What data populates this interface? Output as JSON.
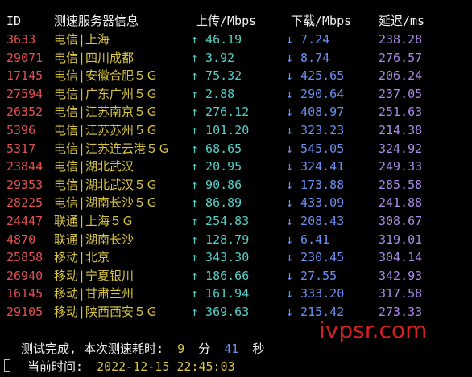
{
  "header": {
    "id": "ID",
    "node": "测速服务器信息",
    "up": "上传/Mbps",
    "down": "下载/Mbps",
    "lat": "延迟/ms"
  },
  "rows": [
    {
      "id": "3633",
      "node": "电信|上海",
      "up": "↑ 46.19",
      "down": "↓ 7.24",
      "lat": "238.28"
    },
    {
      "id": "29071",
      "node": "电信|四川成都",
      "up": "↑ 3.92",
      "down": "↓ 8.74",
      "lat": "276.57"
    },
    {
      "id": "17145",
      "node": "电信|安徽合肥５Ｇ",
      "up": "↑ 75.32",
      "down": "↓ 425.65",
      "lat": "206.24"
    },
    {
      "id": "27594",
      "node": "电信|广东广州５Ｇ",
      "up": "↑ 2.88",
      "down": "↓ 290.64",
      "lat": "237.05"
    },
    {
      "id": "26352",
      "node": "电信|江苏南京５Ｇ",
      "up": "↑ 276.12",
      "down": "↓ 408.97",
      "lat": "251.63"
    },
    {
      "id": "5396",
      "node": "电信|江苏苏州５Ｇ",
      "up": "↑ 101.20",
      "down": "↓ 323.23",
      "lat": "214.38"
    },
    {
      "id": "5317",
      "node": "电信|江苏连云港５Ｇ",
      "up": "↑ 68.65",
      "down": "↓ 545.05",
      "lat": "324.92"
    },
    {
      "id": "23844",
      "node": "电信|湖北武汉",
      "up": "↑ 20.95",
      "down": "↓ 324.41",
      "lat": "249.33"
    },
    {
      "id": "29353",
      "node": "电信|湖北武汉５Ｇ",
      "up": "↑ 90.86",
      "down": "↓ 173.88",
      "lat": "285.58"
    },
    {
      "id": "28225",
      "node": "电信|湖南长沙５Ｇ",
      "up": "↑ 86.89",
      "down": "↓ 433.09",
      "lat": "241.88"
    },
    {
      "id": "24447",
      "node": "联通|上海５Ｇ",
      "up": "↑ 254.83",
      "down": "↓ 208.43",
      "lat": "308.67"
    },
    {
      "id": "4870",
      "node": "联通|湖南长沙",
      "up": "↑ 128.79",
      "down": "↓ 6.41",
      "lat": "319.01"
    },
    {
      "id": "25858",
      "node": "移动|北京",
      "up": "↑ 343.30",
      "down": "↓ 230.45",
      "lat": "304.14"
    },
    {
      "id": "26940",
      "node": "移动|宁夏银川",
      "up": "↑ 186.66",
      "down": "↓ 27.55",
      "lat": "342.93"
    },
    {
      "id": "16145",
      "node": "移动|甘肃兰州",
      "up": "↑ 161.94",
      "down": "↓ 333.20",
      "lat": "317.58"
    },
    {
      "id": "29105",
      "node": "移动|陕西西安５Ｇ",
      "up": "↑ 369.63",
      "down": "↓ 215.42",
      "lat": "273.33"
    }
  ],
  "watermark": "ivpsr.com",
  "footer": {
    "done_label": "测试完成, 本次测速耗时:",
    "minutes": "9",
    "min_unit": "分",
    "seconds": "41",
    "sec_unit": "秒",
    "time_label": "当前时间:",
    "time_value": "2022-12-15 22:45:03"
  },
  "colors": {
    "id": "#e05050",
    "node": "#d7c442",
    "upload": "#52d0c8",
    "download": "#6a8ff0",
    "latency": "#a98be6",
    "watermark": "#d81e1e"
  }
}
